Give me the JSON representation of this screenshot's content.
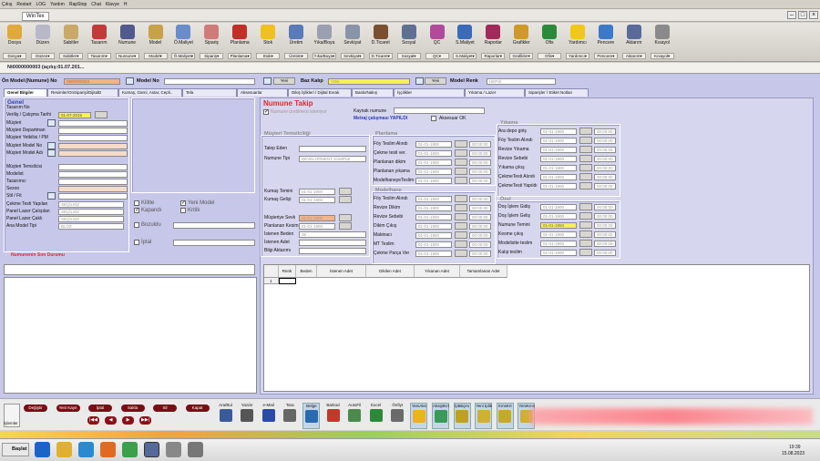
{
  "menu": [
    "Çıkış",
    "Restart",
    "LOG",
    "Yardım",
    "RapStop",
    "Chat",
    "Klavye",
    "H"
  ],
  "window_title": "WinTex",
  "toolbar": [
    {
      "label": "Dosya",
      "sub": "Dosya▾",
      "icon": "folder-icon",
      "color": "#e0a93c"
    },
    {
      "label": "Düzen",
      "sub": "Düzen▾",
      "icon": "edit-icon",
      "color": "#b8b8c8"
    },
    {
      "label": "Sabitler",
      "sub": "Sabitler▾",
      "icon": "constants-icon",
      "color": "#c9a86a"
    },
    {
      "label": "Tasarım",
      "sub": "Tasarım▾",
      "icon": "design-icon",
      "color": "#c23a3a"
    },
    {
      "label": "Numune",
      "sub": "Numune▾",
      "icon": "sample-icon",
      "color": "#505a8c"
    },
    {
      "label": "Model",
      "sub": "Model▾",
      "icon": "model-icon",
      "color": "#c8a24a"
    },
    {
      "label": "Ö.Maliyet",
      "sub": "Ö.Maliyet▾",
      "icon": "cost-icon",
      "color": "#6a8cc8"
    },
    {
      "label": "Sipariş",
      "sub": "Sipariş▾",
      "icon": "order-icon",
      "color": "#d07a7a"
    },
    {
      "label": "Planlama",
      "sub": "Planlama▾",
      "icon": "planning-icon",
      "color": "#c03028"
    },
    {
      "label": "Stok",
      "sub": "Stok▾",
      "icon": "star-icon",
      "color": "#f0c020"
    },
    {
      "label": "Üretim",
      "sub": "Üretim▾",
      "icon": "production-icon",
      "color": "#5a7ab8"
    },
    {
      "label": "Yıka/Boya",
      "sub": "Yıka/Boya▾",
      "icon": "wash-icon",
      "color": "#9aa0b0"
    },
    {
      "label": "Sevkiyat",
      "sub": "Sevkiyat▾",
      "icon": "shipping-icon",
      "color": "#8a94a8"
    },
    {
      "label": "D.Ticaret",
      "sub": "D.Ticaret▾",
      "icon": "trade-icon",
      "color": "#7a5030"
    },
    {
      "label": "Sosyal",
      "sub": "Sosyal▾",
      "icon": "social-icon",
      "color": "#607090"
    },
    {
      "label": "QC",
      "sub": "QC▾",
      "icon": "qc-icon",
      "color": "#b04a9a"
    },
    {
      "label": "S.Maliyet",
      "sub": "S.Maliyet▾",
      "icon": "scost-icon",
      "color": "#3a6ab8"
    },
    {
      "label": "Raporlar",
      "sub": "Raporlar▾",
      "icon": "reports-icon",
      "color": "#a02a5a"
    },
    {
      "label": "Grafikler",
      "sub": "Grafikler▾",
      "icon": "charts-icon",
      "color": "#d09a2a"
    },
    {
      "label": "Ofis",
      "sub": "Ofis▾",
      "icon": "excel-icon",
      "color": "#2a8a3a"
    },
    {
      "label": "Yardımcı",
      "sub": "Yardımcı▾",
      "icon": "smiley-icon",
      "color": "#f0c818"
    },
    {
      "label": "Pencere",
      "sub": "Pencere▾",
      "icon": "window-icon",
      "color": "#3a7ac8"
    },
    {
      "label": "Aktarım",
      "sub": "Aktarım▾",
      "icon": "transfer-icon",
      "color": "#5a6a9a"
    },
    {
      "label": "Kısayol",
      "sub": "Kısayol▾",
      "icon": "shortcut-icon",
      "color": "#8a8a8a"
    }
  ],
  "doc_caption": "Nt0000000003 (açılış:01.07.201...",
  "model_row": {
    "on_model_label": "Ön Model",
    "on_model_hint": "(Numune) No",
    "on_model_value": "0000000003",
    "model_no_label": "Model No",
    "yeni_label": "Yeni",
    "baz_kalip_label": "Baz Kalıp",
    "baz_kalip_value": "YOK",
    "model_renk_label": "Model Renk",
    "model_renk_value": "HEPSİ"
  },
  "tabs": [
    "Genel Bilgiler",
    "Resimler/OnSiparişi/DijitalD",
    "Kumaş, Garni, Astar, Cepli..",
    "Tela",
    "Aksesuarlar",
    "Dikiş İşlikleri / Dijital Evrak",
    "Baskı/Nakış",
    "İşçilikler",
    "Yıkama / Lazer",
    "Siparişler / Etiket Notları"
  ],
  "genel": {
    "title": "Genel",
    "fields": [
      "Tasarım No",
      "Veriliş / Çalışma Tarihi",
      "Müşteri",
      "Müşteri Departman",
      "Müşteri Yetkilisi / PM",
      "Müşteri Model No",
      "Müşteri Model Adı",
      "Müşteri Temsilcisi",
      "Modelist",
      "Tasarımcı",
      "Sezon",
      "Stil / Fit",
      "Çekme Testi Yapılan",
      "Panel Lazer Çalışılan",
      "Panel Lazer Çaklı",
      "Ana Model Tipi"
    ],
    "date_value": "01-07-2015",
    "select_values": [
      "SEÇİLSİZ",
      "SEÇİLSİZ",
      "SEÇİLSİZ",
      "BLOZ"
    ],
    "checks": {
      "kilitle": "Kilitle",
      "yeni_model": "Yeni Model",
      "kapandi": "Kapandı",
      "kritik": "Kritik",
      "bozuldu": "Bozuldu",
      "iptal": "İptal"
    },
    "son_durum_title": "Numunenin Son Durumu"
  },
  "numune_takip": {
    "title": "Numune Takip",
    "uretim_check": "Numune üretilmesi isteniyor",
    "kaynak_label": "Kaynak numune",
    "metraj": "Metraj çalışması YAPILDI",
    "aksesuar_ok": "Aksesuar OK",
    "musteri_title": "Müşteri Temsilciliği",
    "talep_eden": "Talep Eden",
    "numune_tipi": "Numune Tipi",
    "numune_tipi_value": "DEVELOPMENT SAMPLE",
    "kumas_temini": "Kumaş Temini",
    "kumas_gelisi": "Kumaş Gelişi",
    "musteriye_sevk": "Müşteriye Sevk",
    "planlanan_kesim": "Planlanan Kesim",
    "istenen_beden": "İstenen Beden",
    "istenen_beden_value": "36",
    "istenen_adet": "İstenen Adet",
    "bilgi_aktarimi": "Bilgi Aktarımı",
    "date_empty": "01-01-1900",
    "time_empty": "00:00:00",
    "date_hl": "01-01-1950",
    "planlama_title": "Planlama",
    "planlama": [
      "Föy Teslim Alındı",
      "Çekme testi ver.",
      "Planlanan dikim",
      "Planlanan yıkama",
      "ModelhaneyeTeslim"
    ],
    "modelhane_title": "Modelhane",
    "modelhane": [
      "Föy Teslim Alındı",
      "Revize Dikim",
      "Revize Sebebi",
      "Dikim Çıkış",
      "Makinacı",
      "MT Teslim",
      "Çekme Parça Ver"
    ],
    "yikama_title": "Yıkama",
    "yikama": [
      "Ara depo giriş",
      "Föy Teslim Alındı",
      "Revize Yıkama",
      "Revize Sebebi",
      "Yıkama çıkış",
      "ÇekmeTesti Alındı",
      "ÇekmeTesti Yapıldı"
    ],
    "ozel_title": "Özel",
    "ozel": [
      "Doş İşlem Gidiş",
      "Doş İşlem Geliş",
      "Numune Temini",
      "Kesme çıkış",
      "Modelistte teslim",
      "Kalıp teslim"
    ]
  },
  "grid": {
    "headers": [
      "Renk",
      "Beden",
      "İstenen Adet",
      "Dikilen Adet",
      "Yıkanan Adet",
      "Tamamlanan Adet"
    ],
    "row_no": "1"
  },
  "bottom": {
    "islemler": "İşlemler",
    "red_buttons": [
      "Değiştir",
      "Yeni Kayıt",
      "İptal",
      "Sakla",
      "Sil",
      "Kapat"
    ],
    "nav": [
      "|◀◀",
      "◀",
      "▶",
      "▶▶|"
    ],
    "tools": [
      "Ara/Bul",
      "Yazdır",
      "e-Mail",
      "Tara",
      "Belge",
      "Barkod",
      "AutoFil",
      "Excel",
      "Önfiyt",
      "YeniAks",
      "AksiptKrt",
      "İptBiçim",
      "Yeni İplik",
      "KmsKrt",
      "YeniKms"
    ]
  },
  "taskbar": {
    "start": "Başlat",
    "time": "19:39",
    "date": "15.08.2023"
  }
}
